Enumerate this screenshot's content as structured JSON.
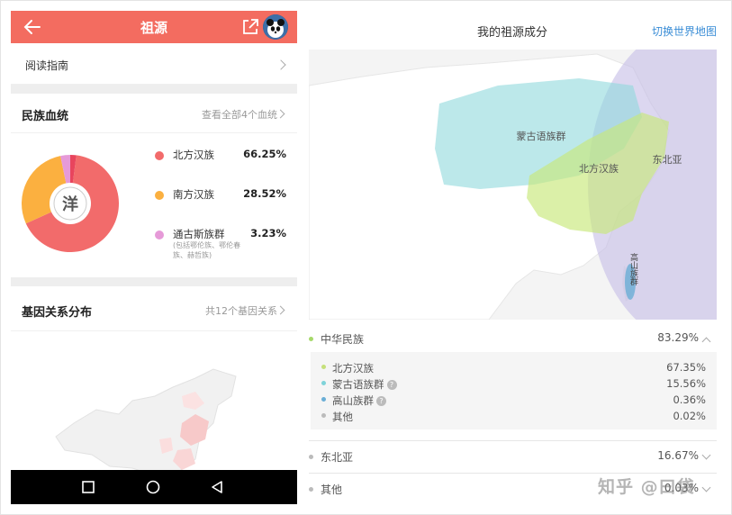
{
  "app": {
    "title": "祖源",
    "back_icon": "arrow-left-icon",
    "share_icon": "external-link-icon",
    "avatar_icon": "panda-avatar-icon",
    "accent_color": "#f36c60"
  },
  "guide": {
    "label": "阅读指南"
  },
  "ethnic": {
    "heading": "民族血统",
    "more": "查看全部4个血统",
    "badge": "洋",
    "items": [
      {
        "name": "北方汉族",
        "pct": "66.25%",
        "value": 66.25,
        "color": "#f26b6b"
      },
      {
        "name": "南方汉族",
        "pct": "28.52%",
        "value": 28.52,
        "color": "#fbb040"
      },
      {
        "name": "通古斯族群",
        "pct": "3.23%",
        "value": 3.23,
        "color": "#e69ad8",
        "sub": "(包括鄂伦族、鄂伦春族、赫哲族)"
      }
    ],
    "other_value": 2.0,
    "other_color": "#e8455d"
  },
  "gene": {
    "heading": "基因关系分布",
    "more": "共12个基因关系"
  },
  "navbar": {
    "square_icon": "recent-apps-icon",
    "circle_icon": "home-icon",
    "triangle_icon": "back-triangle-icon"
  },
  "right": {
    "title": "我的祖源成分",
    "switch_label": "切换世界地图",
    "map_labels": {
      "mongol": "蒙古语族群",
      "north_han": "北方汉族",
      "northeast_asia": "东北亚",
      "gaoshan": "高山族群"
    },
    "groups": [
      {
        "name": "中华民族",
        "value": "83.29%",
        "dot": "#a6d96a",
        "expanded": true,
        "children": [
          {
            "name": "北方汉族",
            "value": "67.35%",
            "dot": "#c5e07a",
            "help": false
          },
          {
            "name": "蒙古语族群",
            "value": "15.56%",
            "dot": "#7fd3d9",
            "help": true
          },
          {
            "name": "高山族群",
            "value": "0.36%",
            "dot": "#6aaed6",
            "help": true
          },
          {
            "name": "其他",
            "value": "0.02%",
            "dot": "#bbbbbb",
            "help": false
          }
        ]
      },
      {
        "name": "东北亚",
        "value": "16.67%",
        "dot": "#bbbbbb",
        "expanded": false
      },
      {
        "name": "其他",
        "value": "0.03%",
        "dot": "#bbbbbb",
        "expanded": false
      }
    ],
    "help_mark": "?"
  },
  "watermark": "知乎 @曰袋"
}
